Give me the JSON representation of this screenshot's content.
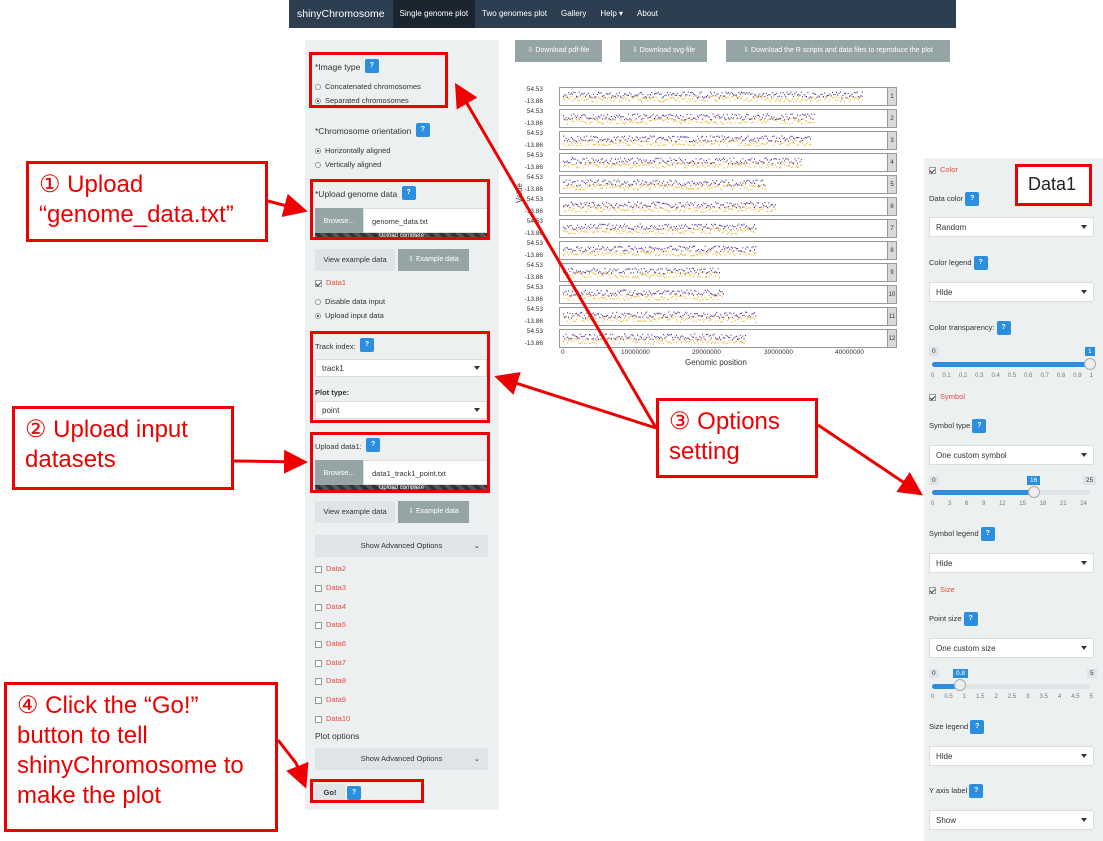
{
  "nav": {
    "brand": "shinyChromosome",
    "items": [
      "Single genome plot",
      "Two genomes plot",
      "Gallery",
      "Help ▾",
      "About"
    ]
  },
  "sidebar": {
    "image_type_label": "*Image type",
    "image_type_options": [
      "Concatenated chromosomes",
      "Separated chromosomes"
    ],
    "orientation_label": "*Chromosome orientation",
    "orientation_options": [
      "Horizontally aligned",
      "Vertically aligned"
    ],
    "upload_genome_label": "*Upload genome data",
    "browse": "Browse...",
    "genome_file": "genome_data.txt",
    "upload_complete": "Upload complete",
    "view_example": "View example data",
    "example_data": "⇩ Example data",
    "data1": "Data1",
    "data_input_options": [
      "Disable data input",
      "Upload input data"
    ],
    "track_index_label": "Track index:",
    "track_index_value": "track1",
    "plot_type_label": "Plot type:",
    "plot_type_value": "point",
    "upload_data1_label": "Upload data1:",
    "data1_file": "data1_track1_point.txt",
    "show_advanced": "Show Advanced Options",
    "data_items": [
      "Data2",
      "Data3",
      "Data4",
      "Data5",
      "Data6",
      "Data7",
      "Data8",
      "Data9",
      "Data10"
    ],
    "plot_options": "Plot options",
    "go": "Go!"
  },
  "downloads": {
    "pdf": "⇩ Download pdf-file",
    "svg": "⇩ Download svg-file",
    "scripts": "⇩ Download the R scripts and data files to reproduce the plot"
  },
  "plot": {
    "y_top": "54.53",
    "y_bottom": "-13.86",
    "ylabel": "Value",
    "xlabel": "Genomic position",
    "xticks": [
      "0",
      "10000000",
      "20000000",
      "30000000",
      "40000000"
    ],
    "tracks": [
      "1",
      "2",
      "3",
      "4",
      "5",
      "6",
      "7",
      "8",
      "9",
      "10",
      "11",
      "12"
    ]
  },
  "options_panel": {
    "title": "Data1",
    "color": "Color",
    "data_color_label": "Data color",
    "data_color_value": "Random",
    "color_legend_label": "Color legend",
    "color_legend_value": "Hide",
    "transparency_label": "Color transparency:",
    "transparency_min": "0",
    "transparency_value": "1",
    "transparency_ticks": [
      "0",
      "0.1",
      "0.2",
      "0.3",
      "0.4",
      "0.5",
      "0.6",
      "0.7",
      "0.8",
      "0.9",
      "1"
    ],
    "symbol": "Symbol",
    "symbol_type_label": "Symbol type",
    "symbol_type_value": "One custom symbol",
    "symbol_min": "0",
    "symbol_value": "16",
    "symbol_max": "25",
    "symbol_ticks": [
      "0",
      "3",
      "6",
      "9",
      "12",
      "15",
      "18",
      "21",
      "24"
    ],
    "symbol_legend_label": "Symbol legend",
    "symbol_legend_value": "Hide",
    "size": "Size",
    "point_size_label": "Point size",
    "point_size_value": "One custom size",
    "size_min": "0",
    "size_value": "0.8",
    "size_max": "5",
    "size_ticks": [
      "0",
      "0.5",
      "1",
      "1.5",
      "2",
      "2.5",
      "3",
      "3.5",
      "4",
      "4.5",
      "5"
    ],
    "size_legend_label": "Size legend",
    "size_legend_value": "Hide",
    "yaxis_label": "Y axis label",
    "yaxis_value": "Show"
  },
  "callouts": {
    "c1_line1": "① Upload",
    "c1_line2": "“genome_data.txt”",
    "c2_line1": "② Upload input",
    "c2_line2": "datasets",
    "c3_line1": "③ Options",
    "c3_line2": "setting",
    "c4_line1": "④ Click the “Go!”",
    "c4_line2": "button to tell",
    "c4_line3": "shinyChromosome to",
    "c4_line4": "make the plot"
  },
  "colors": {
    "accent": "#2c8ee0",
    "navbar": "#2c3e50",
    "annotation": "#e00000",
    "sidebar": "#ecf0f1"
  }
}
